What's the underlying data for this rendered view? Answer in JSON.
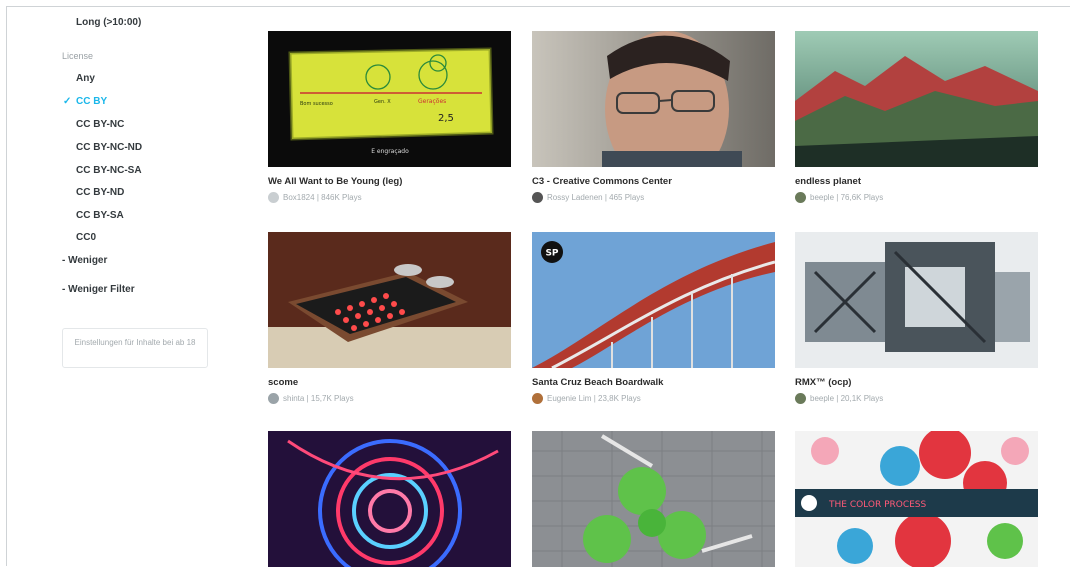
{
  "sidebar": {
    "duration_long": "Long (>10:00)",
    "license_heading": "License",
    "license_options": [
      "Any",
      "CC BY",
      "CC BY-NC",
      "CC BY-NC-ND",
      "CC BY-NC-SA",
      "CC BY-ND",
      "CC BY-SA",
      "CC0"
    ],
    "selected_license": "CC BY",
    "check_glyph": "✓",
    "less_link": "- Weniger",
    "less_filters_link": "- Weniger Filter",
    "save_button": "Einstellungen für Inhalte bei ab 18"
  },
  "videos": [
    {
      "title": "We All Want to Be Young (leg)",
      "user": "Box1824",
      "plays": "| 846K Plays",
      "avatar_color": "#c9ced1"
    },
    {
      "title": "C3 - Creative Commons Center",
      "user": "Rossy Ladenen",
      "plays": "| 465 Plays",
      "avatar_color": "#555555"
    },
    {
      "title": "endless planet",
      "user": "beeple",
      "plays": "| 76,6K Plays",
      "avatar_color": "#6a7a5a"
    },
    {
      "title": "scome",
      "user": "shinta",
      "plays": "| 15,7K Plays",
      "avatar_color": "#9aa3a8"
    },
    {
      "title": "Santa Cruz Beach Boardwalk",
      "user": "Eugenie Lim",
      "plays": "| 23,8K Plays",
      "avatar_color": "#b0703a"
    },
    {
      "title": "RMX™ (ocp)",
      "user": "beeple",
      "plays": "| 20,1K Plays",
      "avatar_color": "#6a7a5a"
    },
    {
      "title": "",
      "user": "",
      "plays": ""
    },
    {
      "title": "",
      "user": "",
      "plays": ""
    },
    {
      "title": "",
      "user": "",
      "plays": ""
    }
  ],
  "thumb_texts": {
    "chalk_sub": "E engraçado",
    "chalk_a": "Bom sucesso",
    "chalk_b": "Gen. X",
    "chalk_c": "Gerações",
    "chalk_num": "2,5",
    "sp_badge": "SP",
    "poster_text": "THE COLOR PROCESS"
  },
  "colors": {
    "accent": "#1ab7ea",
    "text": "#2b2b2b",
    "muted": "#a3aaae"
  }
}
